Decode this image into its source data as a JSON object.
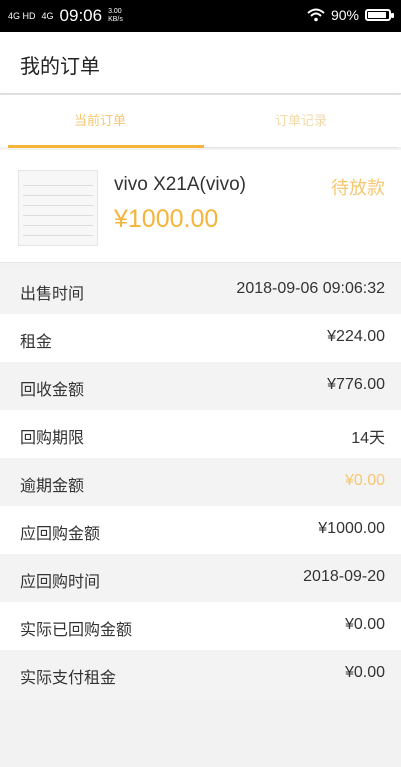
{
  "status_bar": {
    "network1": "4G HD",
    "network2": "4G",
    "time": "09:06",
    "speed": "3.00\nKB/s",
    "battery": "90%",
    "battery_level": 0.9
  },
  "header": {
    "title": "我的订单"
  },
  "tabs": [
    {
      "label": "当前订单",
      "active": true
    },
    {
      "label": "订单记录",
      "active": false
    }
  ],
  "product": {
    "name": "vivo X21A(vivo)",
    "price": "¥1000.00",
    "status": "待放款"
  },
  "details": [
    {
      "label": "出售时间",
      "value": "2018-09-06 09:06:32"
    },
    {
      "label": "租金",
      "value": "¥224.00"
    },
    {
      "label": "回收金额",
      "value": "¥776.00"
    },
    {
      "label": "回购期限",
      "value": "14天"
    },
    {
      "label": "逾期金额",
      "value": "¥0.00",
      "accent": true
    },
    {
      "label": "应回购金额",
      "value": "¥1000.00"
    },
    {
      "label": "应回购时间",
      "value": "2018-09-20"
    },
    {
      "label": "实际已回购金额",
      "value": "¥0.00"
    },
    {
      "label": "实际支付租金",
      "value": "¥0.00"
    }
  ],
  "colors": {
    "accent": "#f5b43a",
    "accent_light": "#f6c770"
  }
}
